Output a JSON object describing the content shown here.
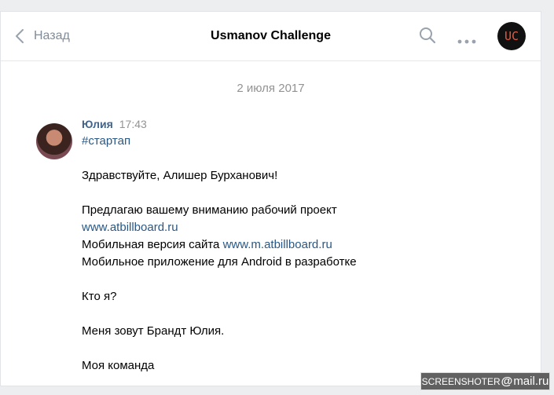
{
  "header": {
    "back_label": "Назад",
    "title": "Usmanov Challenge",
    "chat_avatar_text": "UC"
  },
  "date": "2 июля 2017",
  "message": {
    "author": "Юлия",
    "time": "17:43",
    "hashtag": "#стартап",
    "greeting": "Здравствуйте, Алишер Бурханович!",
    "line1": "Предлагаю вашему вниманию рабочий проект",
    "link1": "www.atbillboard.ru",
    "line2_prefix": "Мобильная версия сайта",
    "link2": "www.m.atbillboard.ru",
    "line3": "Мобильное приложение для Android в разработке",
    "line4": "Кто я?",
    "line5": "Меня зовут Брандт Юлия.",
    "line6": "Моя команда"
  },
  "watermark": {
    "left": "SCREENSHOTER",
    "at": "@",
    "right": "mail.ru"
  },
  "colors": {
    "accent": "#2a5885",
    "author": "#42648b",
    "muted": "#939393",
    "icon": "#818c99"
  }
}
